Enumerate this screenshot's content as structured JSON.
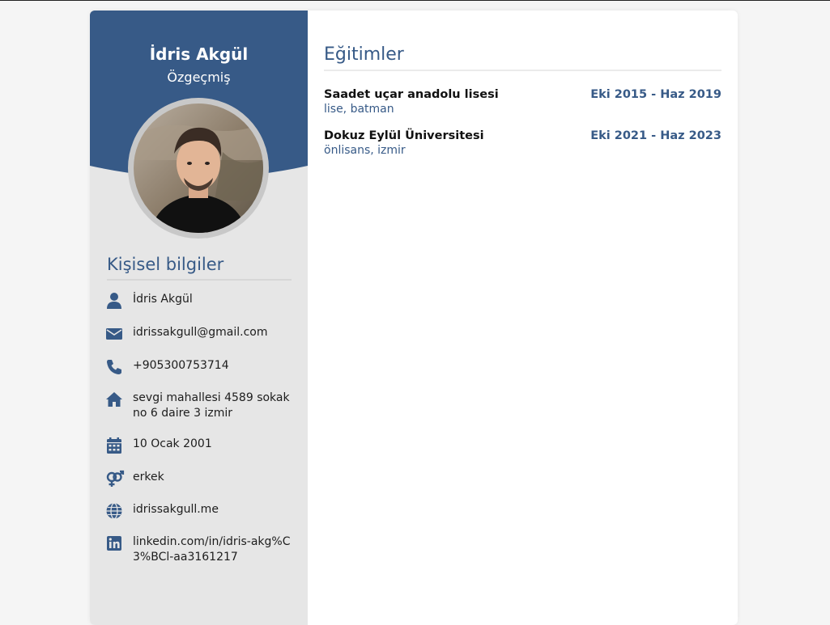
{
  "profile": {
    "name": "İdris Akgül",
    "subtitle": "Özgeçmiş"
  },
  "theme": {
    "accent": "#375a87",
    "sidebar_bg": "#e6e6e6"
  },
  "personal": {
    "title": "Kişisel bilgiler",
    "items": [
      {
        "icon": "user-icon",
        "text": "İdris Akgül"
      },
      {
        "icon": "envelope-icon",
        "text": "idrissakgull@gmail.com"
      },
      {
        "icon": "phone-icon",
        "text": "+905300753714"
      },
      {
        "icon": "home-icon",
        "text": "sevgi mahallesi 4589 sokak no 6 daire 3 izmir"
      },
      {
        "icon": "calendar-icon",
        "text": "10 Ocak 2001"
      },
      {
        "icon": "gender-icon",
        "text": "erkek"
      },
      {
        "icon": "globe-icon",
        "text": "idrissakgull.me"
      },
      {
        "icon": "linkedin-icon",
        "text": "linkedin.com/in/idris-akg%C3%BCl-aa3161217"
      }
    ]
  },
  "education": {
    "title": "Eğitimler",
    "items": [
      {
        "school": "Saadet uçar anadolu lisesi",
        "dates": "Eki 2015 - Haz 2019",
        "detail": "lise, batman"
      },
      {
        "school": "Dokuz Eylül Üniversitesi",
        "dates": "Eki 2021 - Haz 2023",
        "detail": "önlisans, izmir"
      }
    ]
  }
}
